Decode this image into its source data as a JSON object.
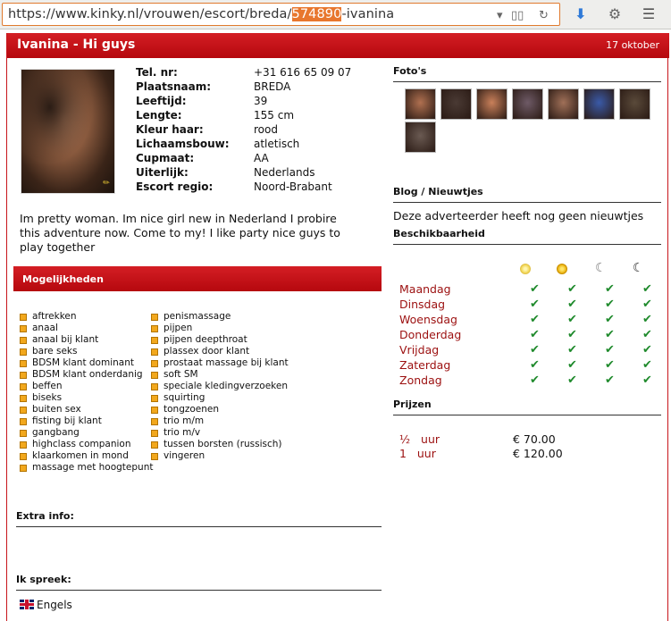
{
  "browser": {
    "url_prefix": "https://www.kinky.nl/vrouwen/escort/breda/",
    "url_highlight": "574890",
    "url_suffix": "-ivanina"
  },
  "header": {
    "title": "Ivanina - Hi guys",
    "date": "17 oktober"
  },
  "profile": {
    "fields": [
      {
        "label": "Tel. nr:",
        "value": "+31 616 65 09 07"
      },
      {
        "label": "Plaatsnaam:",
        "value": "BREDA"
      },
      {
        "label": "Leeftijd:",
        "value": "39"
      },
      {
        "label": "Lengte:",
        "value": "155 cm"
      },
      {
        "label": "Kleur haar:",
        "value": "rood"
      },
      {
        "label": "Lichaamsbouw:",
        "value": "atletisch"
      },
      {
        "label": "Cupmaat:",
        "value": "AA"
      },
      {
        "label": "Uiterlijk:",
        "value": "Nederlands"
      },
      {
        "label": "Escort regio:",
        "value": "Noord-Brabant"
      }
    ],
    "description": "Im pretty woman. Im nice girl new in Nederland I probire this adventure now. Come to my! I like party nice guys to play together"
  },
  "options": {
    "title": "Mogelijkheden",
    "col1": [
      "aftrekken",
      "anaal",
      "anaal bij klant",
      "bare seks",
      "BDSM klant dominant",
      "BDSM klant onderdanig",
      "beffen",
      "biseks",
      "buiten sex",
      "fisting bij klant",
      "gangbang",
      "highclass companion",
      "klaarkomen in mond",
      "massage met hoogtepunt"
    ],
    "col2": [
      "penismassage",
      "pijpen",
      "pijpen deepthroat",
      "plassex door klant",
      "prostaat massage bij klant",
      "soft SM",
      "speciale kledingverzoeken",
      "squirting",
      "tongzoenen",
      "trio m/m",
      "trio m/v",
      "tussen borsten (russisch)",
      "vingeren"
    ]
  },
  "extra": {
    "title": "Extra info:"
  },
  "languages": {
    "title": "Ik spreek:",
    "items": [
      "Engels"
    ]
  },
  "photos": {
    "title": "Foto's",
    "thumb_colors": [
      "#b07050",
      "#4a3a34",
      "#c9805a",
      "#6e5a66",
      "#a07058",
      "#3a5aa8",
      "#5a4a3a",
      "#6a5a52"
    ]
  },
  "blog": {
    "title": "Blog / Nieuwtjes",
    "text": "Deze adverteerder heeft nog geen nieuwtjes"
  },
  "availability": {
    "title": "Beschikbaarheid",
    "days": [
      "Maandag",
      "Dinsdag",
      "Woensdag",
      "Donderdag",
      "Vrijdag",
      "Zaterdag",
      "Zondag"
    ],
    "check": "✔",
    "periods": [
      "morning",
      "afternoon",
      "evening",
      "night"
    ]
  },
  "prices": {
    "title": "Prijzen",
    "rows": [
      {
        "qty": "½",
        "unit": "uur",
        "price": "€ 70.00"
      },
      {
        "qty": "1",
        "unit": "uur",
        "price": "€ 120.00"
      }
    ]
  },
  "colors": {
    "brand_red": "#c8151b",
    "day_red": "#9c1010",
    "check_green": "#1f8a2c"
  }
}
